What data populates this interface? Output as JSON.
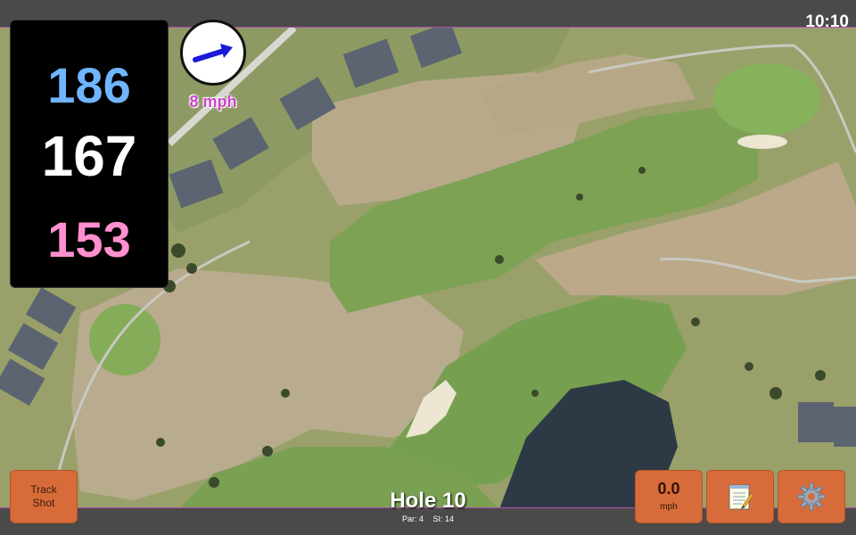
{
  "status_bar": {
    "time": "10:10"
  },
  "distances": {
    "back": "186",
    "middle": "167",
    "front": "153"
  },
  "wind": {
    "speed_label": "8 mph",
    "direction": "east"
  },
  "hole": {
    "title": "Hole 10",
    "par": "Par: 4",
    "stroke_index": "SI: 14"
  },
  "buttons": {
    "track_shot_line1": "Track",
    "track_shot_line2": "Shot",
    "wind_value": "0.0",
    "wind_unit": "mph",
    "notes_icon": "notepad-icon",
    "settings_icon": "gear-icon"
  },
  "colors": {
    "back_distance": "#6fb5ff",
    "middle_distance": "#ffffff",
    "front_distance": "#ff8fcf",
    "button": "#d76c3a",
    "wind_label": "#c846c8"
  }
}
